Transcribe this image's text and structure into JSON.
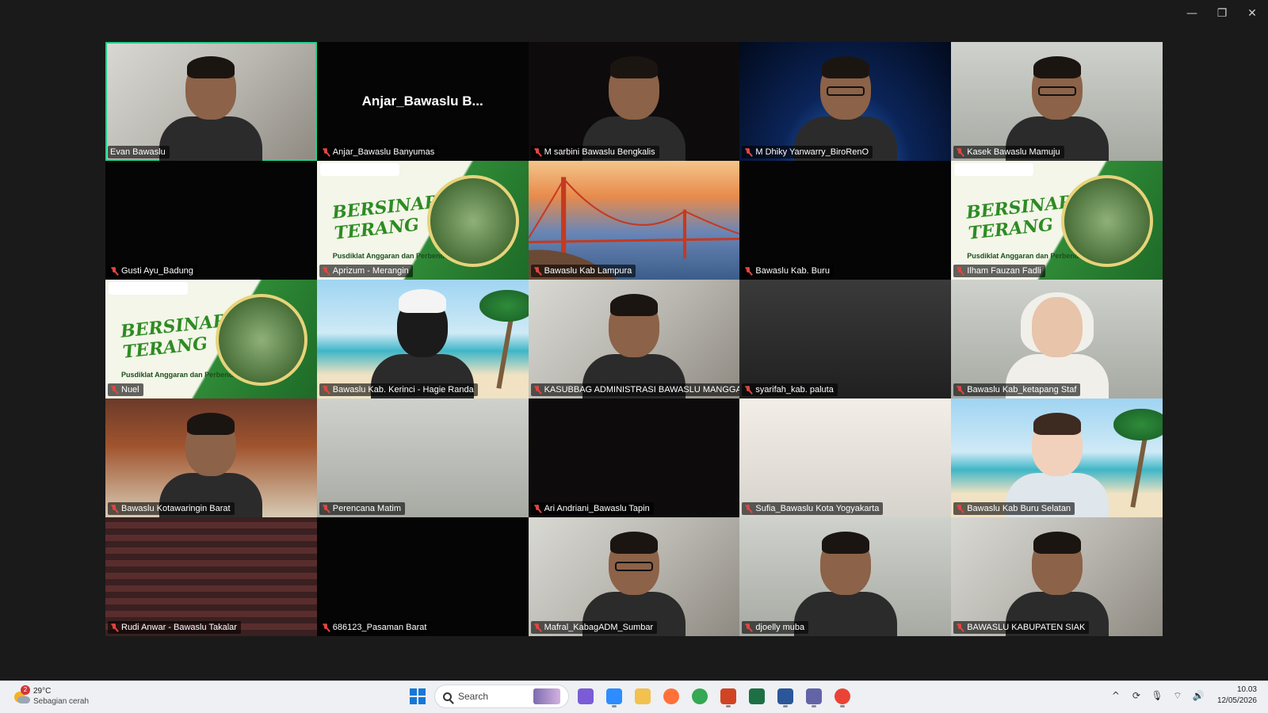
{
  "window": {
    "controls": {
      "minimize": "—",
      "restore": "❐",
      "close": "✕"
    }
  },
  "meeting": {
    "active_speaker": "Evan Bawaslu",
    "tiles": [
      {
        "name": "Evan Bawaslu",
        "muted": false,
        "bg": "bg-office",
        "person": "default",
        "active": true
      },
      {
        "name": "Anjar_Bawaslu Banyumas",
        "muted": true,
        "bg": "bg-dark",
        "big_name": "Anjar_Bawaslu B..."
      },
      {
        "name": "M sarbini Bawaslu Bengkalis",
        "muted": true,
        "bg": "bg-blackish",
        "person": "default"
      },
      {
        "name": "M Dhiky Yanwarry_BiroRenO",
        "muted": true,
        "bg": "bg-space",
        "person": "glasses"
      },
      {
        "name": "Kasek Bawaslu Mamuju",
        "muted": true,
        "bg": "bg-wall",
        "person": "glasses"
      },
      {
        "name": "Gusti Ayu_Badung",
        "muted": true,
        "bg": "bg-dark"
      },
      {
        "name": "Aprizum - Merangin",
        "muted": true,
        "bg": "bersinar"
      },
      {
        "name": "Bawaslu Kab Lampura",
        "muted": true,
        "bg": "bg-bridge",
        "bridge": true
      },
      {
        "name": "Bawaslu Kab. Buru",
        "muted": true,
        "bg": "bg-dark"
      },
      {
        "name": "Ilham Fauzan Fadli",
        "muted": true,
        "bg": "bersinar"
      },
      {
        "name": "Nuel",
        "muted": true,
        "bg": "bersinar"
      },
      {
        "name": "Bawaslu Kab. Kerinci - Hagie Randa",
        "muted": true,
        "bg": "bg-beach",
        "person": "avatar-old",
        "palm": true
      },
      {
        "name": "KASUBBAG ADMINISTRASI BAWASLU MANGGAR...",
        "muted": true,
        "bg": "bg-office",
        "person": "default"
      },
      {
        "name": "syarifah_kab. paluta",
        "muted": true,
        "bg": "bg-gray"
      },
      {
        "name": "Bawaslu Kab_ketapang Staf",
        "muted": true,
        "bg": "bg-wall",
        "person": "hijab"
      },
      {
        "name": "Bawaslu Kotawaringin Barat",
        "muted": true,
        "bg": "bg-media",
        "person": "default"
      },
      {
        "name": "Perencana Matim",
        "muted": true,
        "bg": "bg-wall"
      },
      {
        "name": "Ari Andriani_Bawaslu Tapin",
        "muted": true,
        "bg": "bg-blackish"
      },
      {
        "name": "Sufia_Bawaslu Kota Yogyakarta",
        "muted": true,
        "bg": "bg-blurred"
      },
      {
        "name": "Bawaslu Kab Buru Selatan",
        "muted": true,
        "bg": "bg-beach",
        "person": "avatar-girl",
        "palm": true
      },
      {
        "name": "Rudi Anwar - Bawaslu Takalar",
        "muted": true,
        "bg": "bg-mediactr"
      },
      {
        "name": "686123_Pasaman Barat",
        "muted": true,
        "bg": "bg-dark"
      },
      {
        "name": "Mafral_KabagADM_Sumbar",
        "muted": true,
        "bg": "bg-office",
        "person": "glasses"
      },
      {
        "name": "djoelly muba",
        "muted": true,
        "bg": "bg-wall",
        "person": "default"
      },
      {
        "name": "BAWASLU KABUPATEN SIAK",
        "muted": true,
        "bg": "bg-office",
        "person": "default"
      }
    ],
    "bersinar": {
      "title": "BERSINAR TERANG",
      "subtitle": "Pusdiklat Anggaran dan Perbendaharaan"
    }
  },
  "taskbar": {
    "weather": {
      "temp": "29°C",
      "condition": "Sebagian cerah",
      "badge": "2"
    },
    "search": {
      "placeholder": "Search"
    },
    "apps": [
      {
        "name": "copilot-icon",
        "color": "#7b5cd6"
      },
      {
        "name": "zoom-icon",
        "color": "#2d8cff",
        "running": true
      },
      {
        "name": "file-explorer-icon",
        "color": "#f2c14e"
      },
      {
        "name": "firefox-icon",
        "color": "#ff7139"
      },
      {
        "name": "chrome-icon",
        "color": "#34a853"
      },
      {
        "name": "powerpoint-icon",
        "color": "#d04423",
        "running": true
      },
      {
        "name": "excel-icon",
        "color": "#1d7044"
      },
      {
        "name": "word-icon",
        "color": "#2b579a",
        "running": true
      },
      {
        "name": "teams-icon",
        "color": "#6264a7",
        "running": true
      },
      {
        "name": "chrome-alt-icon",
        "color": "#ea4335",
        "running": true
      }
    ],
    "tray": {
      "chevron": "^",
      "sync": "⟳",
      "mic": "🎙",
      "wifi": "⌔",
      "volume": "🔊"
    },
    "clock": {
      "time": "10.03",
      "date": "12/05/2026"
    }
  }
}
